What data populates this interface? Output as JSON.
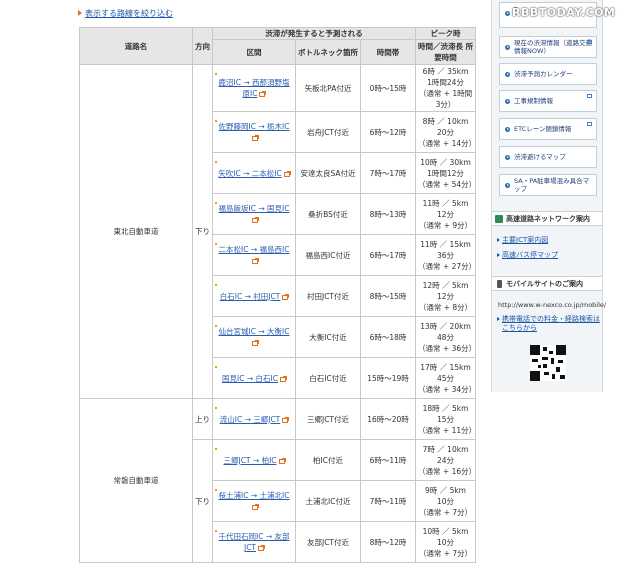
{
  "filter_link": "表示する路線を絞り込む",
  "watermark": "RBBTODAY.COM",
  "table": {
    "headers": {
      "road": "道路名",
      "direction": "方向",
      "forecast_group": "渋滞が発生すると予測される",
      "section": "区間",
      "bottleneck": "ボトルネック箇所",
      "time": "時間帯",
      "peak_group": "ピーク時",
      "peak_detail": "時間／渋滞長 所要時間"
    },
    "groups": [
      {
        "road": "東北自動車道",
        "direction": "下り",
        "rows": [
          {
            "section": "鹿沼IC → 西那須野塩原IC",
            "bottleneck": "矢板北PA付近",
            "time": "0時〜15時",
            "peak1": "6時 ／ 35km",
            "peak2": "1時間24分",
            "peak3": "（通常 + 1時間3分）"
          },
          {
            "section": "佐野藤岡IC → 栃木IC",
            "bottleneck": "岩舟JCT付近",
            "time": "6時〜12時",
            "peak1": "8時 ／ 10km",
            "peak2": "20分",
            "peak3": "（通常 + 14分）"
          },
          {
            "section": "矢吹IC → 二本松IC",
            "bottleneck": "安達太良SA付近",
            "time": "7時〜17時",
            "peak1": "10時 ／ 30km",
            "peak2": "1時間12分",
            "peak3": "（通常 + 54分）"
          },
          {
            "section": "福島飯坂IC → 国見IC",
            "bottleneck": "桑折BS付近",
            "time": "8時〜13時",
            "peak1": "11時 ／ 5km",
            "peak2": "12分",
            "peak3": "（通常 + 9分）"
          },
          {
            "section": "二本松IC → 福島西IC",
            "bottleneck": "福島西IC付近",
            "time": "6時〜17時",
            "peak1": "11時 ／ 15km",
            "peak2": "36分",
            "peak3": "（通常 + 27分）"
          },
          {
            "section": "白石IC → 村田JCT",
            "bottleneck": "村田JCT付近",
            "time": "8時〜15時",
            "peak1": "12時 ／ 5km",
            "peak2": "12分",
            "peak3": "（通常 + 8分）"
          },
          {
            "section": "仙台宮城IC → 大衡IC",
            "bottleneck": "大衡IC付近",
            "time": "6時〜18時",
            "peak1": "13時 ／ 20km",
            "peak2": "48分",
            "peak3": "（通常 + 36分）"
          },
          {
            "section": "国見IC → 白石IC",
            "bottleneck": "白石IC付近",
            "time": "15時〜19時",
            "peak1": "17時 ／ 15km",
            "peak2": "45分",
            "peak3": "（通常 + 34分）"
          }
        ]
      },
      {
        "road": "常磐自動車道",
        "subgroups": [
          {
            "direction": "上り",
            "rows": [
              {
                "section": "流山IC → 三郷JCT",
                "bottleneck": "三郷JCT付近",
                "time": "16時〜20時",
                "peak1": "18時 ／ 5km",
                "peak2": "15分",
                "peak3": "（通常 + 11分）"
              }
            ]
          },
          {
            "direction": "下り",
            "rows": [
              {
                "section": "三郷JCT → 柏IC",
                "bottleneck": "柏IC付近",
                "time": "6時〜11時",
                "peak1": "7時 ／ 10km",
                "peak2": "24分",
                "peak3": "（通常 + 16分）"
              },
              {
                "section": "桜土浦IC → 土浦北IC",
                "bottleneck": "土浦北IC付近",
                "time": "7時〜11時",
                "peak1": "9時 ／ 5km",
                "peak2": "10分",
                "peak3": "（通常 + 7分）"
              },
              {
                "section": "千代田石岡IC → 友部JCT",
                "bottleneck": "友部JCT付近",
                "time": "8時〜12時",
                "peak1": "10時 ／ 5km",
                "peak2": "10分",
                "peak3": "（通常 + 7分）"
              }
            ]
          }
        ]
      }
    ]
  },
  "sidebar": {
    "top_buttons": [
      {
        "label": "ﾌ",
        "icon": "arrow-circle-icon"
      },
      {
        "label": "現在の渋滞情報（道路交通情報NOW）",
        "icon": "arrow-circle-icon"
      },
      {
        "label": "渋滞予測カレンダー",
        "icon": "arrow-circle-icon"
      },
      {
        "label": "工事規制情報",
        "icon": "arrow-circle-icon"
      },
      {
        "label": "ETCレーン閉鎖情報",
        "icon": "arrow-circle-icon"
      },
      {
        "label": "渋滞避けるマップ",
        "icon": "arrow-circle-icon"
      },
      {
        "label": "SA・PA駐車場混み具合マップ",
        "icon": "arrow-circle-icon"
      }
    ],
    "network_heading": "高速道路ネットワーク案内",
    "network_links": [
      "主要JCT案内図",
      "高速バス停マップ"
    ],
    "mobile_heading": "モバイルサイトのご案内",
    "mobile_url": "http://www.w-nexco.co.jp/mobile/",
    "mobile_link": "携帯電話での料金・経路検索はこちらから"
  }
}
